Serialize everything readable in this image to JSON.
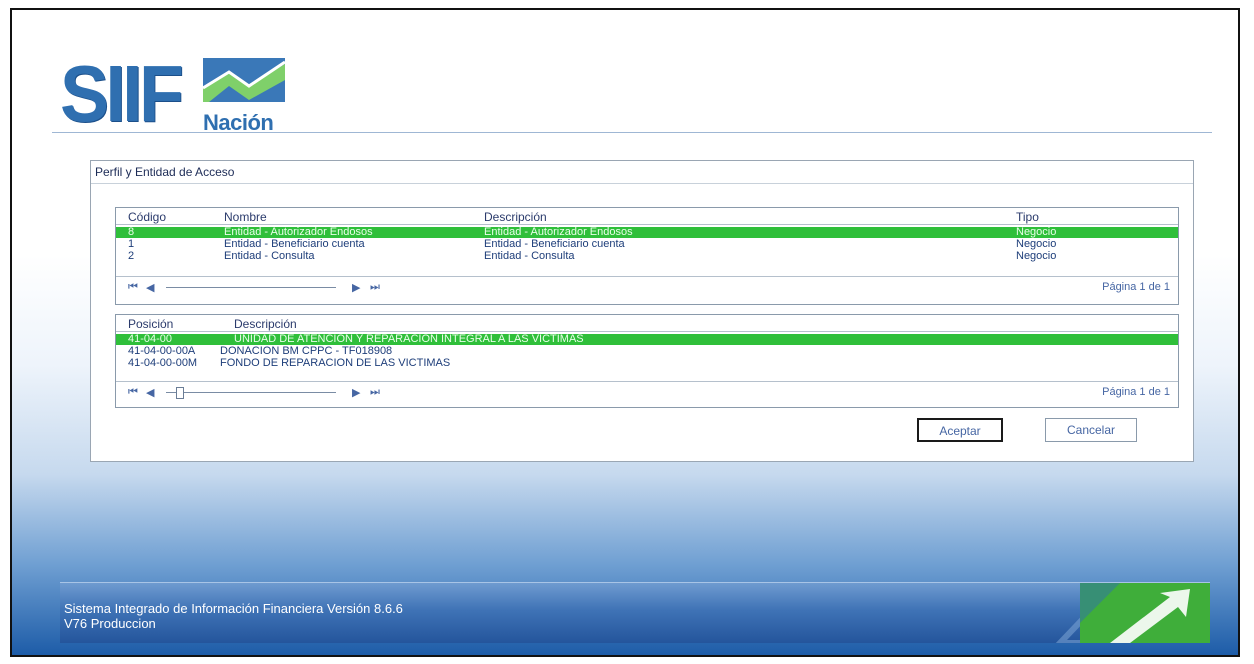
{
  "logo": {
    "main": "SIIF",
    "sub": "Nación"
  },
  "panel": {
    "title": "Perfil y Entidad de Acceso",
    "profiles": {
      "headers": {
        "code": "Código",
        "name": "Nombre",
        "description": "Descripción",
        "type": "Tipo"
      },
      "rows": [
        {
          "code": "8",
          "name": "Entidad - Autorizador Endosos",
          "description": "Entidad - Autorizador Endosos",
          "type": "Negocio",
          "selected": true
        },
        {
          "code": "1",
          "name": "Entidad - Beneficiario cuenta",
          "description": "Entidad - Beneficiario cuenta",
          "type": "Negocio",
          "selected": false
        },
        {
          "code": "2",
          "name": "Entidad - Consulta",
          "description": "Entidad - Consulta",
          "type": "Negocio",
          "selected": false
        }
      ],
      "page_info": "Página 1 de 1"
    },
    "positions": {
      "headers": {
        "position": "Posición",
        "description": "Descripción"
      },
      "rows": [
        {
          "position": "41-04-00",
          "description": "UNIDAD DE ATENCION Y REPARACION INTEGRAL A LAS VICTIMAS",
          "selected": true
        },
        {
          "position": "41-04-00-00A",
          "description": "DONACION BM CPPC - TF018908",
          "selected": false
        },
        {
          "position": "41-04-00-00M",
          "description": "FONDO DE REPARACION DE LAS VICTIMAS",
          "selected": false
        }
      ],
      "page_info": "Página 1 de 1"
    },
    "buttons": {
      "accept": "Aceptar",
      "cancel": "Cancelar"
    },
    "pager_icons": {
      "first": "⏮",
      "prev": "◀",
      "next": "▶",
      "last": "⏭"
    }
  },
  "footer": {
    "line1": "Sistema Integrado de Información Financiera Versión 8.6.6",
    "line2": "V76 Produccion"
  },
  "colors": {
    "selected_row": "#2fbf3a",
    "brand_blue": "#2f6fb0",
    "footer_blue": "#24559c",
    "accent_green": "#2fbf3a"
  }
}
